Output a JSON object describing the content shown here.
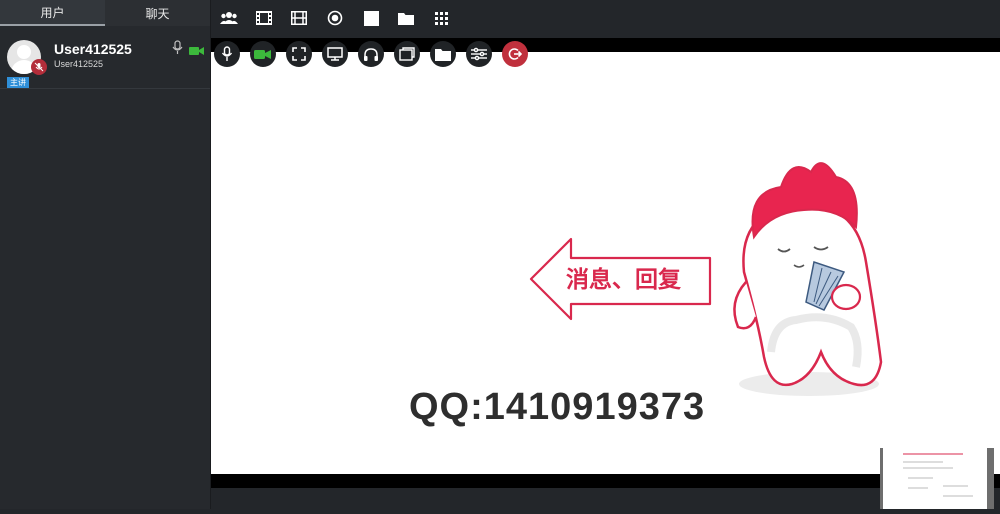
{
  "sidebar": {
    "tabs": [
      {
        "label": "用户",
        "active": true
      },
      {
        "label": "聊天",
        "active": false
      }
    ],
    "users": [
      {
        "name": "User412525",
        "id": "User412525",
        "badge": "主讲",
        "mic_status": "muted"
      }
    ]
  },
  "toolbar": {
    "icons": [
      "users-icon",
      "film-strip-icon",
      "video-file-icon",
      "record-icon",
      "whiteboard-icon",
      "folder-icon",
      "grid-icon"
    ]
  },
  "controls": {
    "icons": [
      "microphone-icon",
      "camera-icon",
      "fullscreen-icon",
      "screen-share-icon",
      "headphones-icon",
      "window-icon",
      "folder-icon",
      "settings-sliders-icon",
      "exit-icon"
    ]
  },
  "slide": {
    "arrow_text": "消息、回复",
    "qq_text": "QQ:1410919373"
  },
  "colors": {
    "accent_red": "#d9284d",
    "camera_green": "#3cb93c",
    "badge_blue": "#2f8fd8"
  }
}
